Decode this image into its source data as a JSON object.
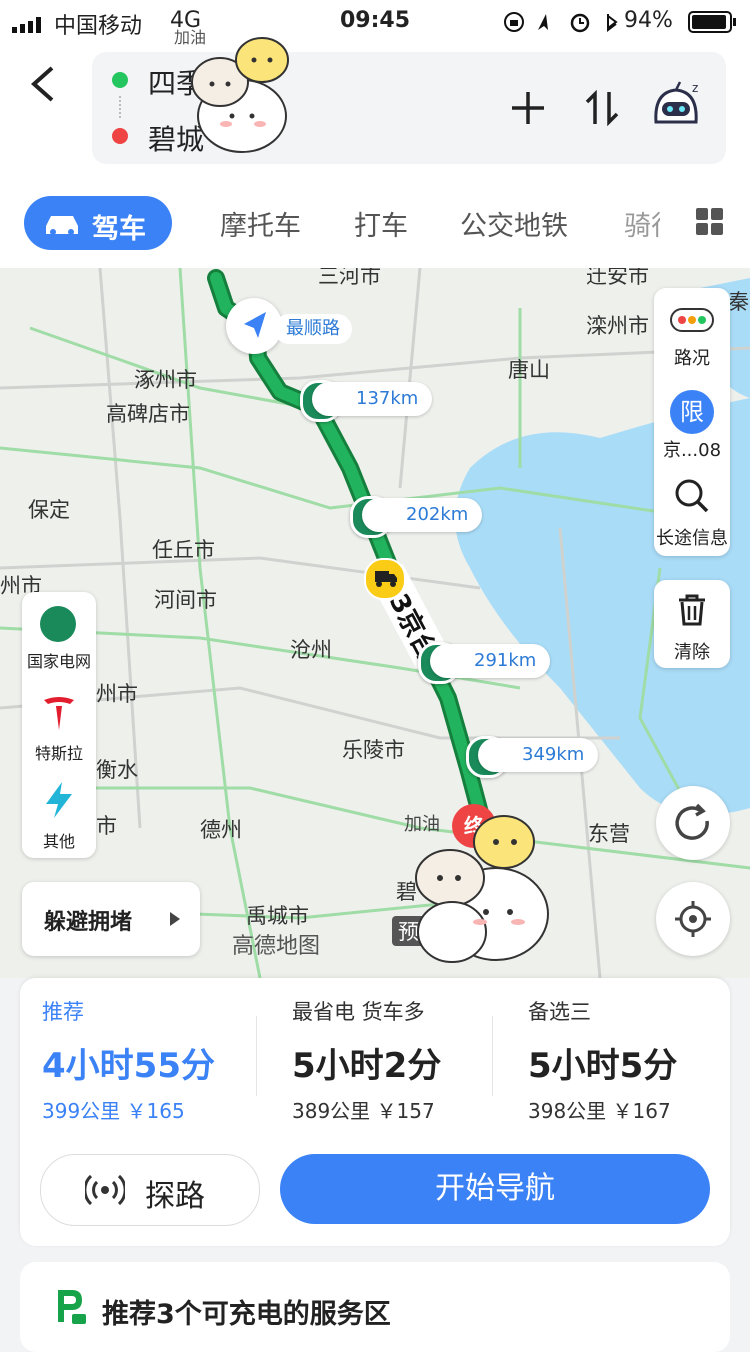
{
  "status_bar": {
    "carrier": "中国移动",
    "network": "4G",
    "time": "09:45",
    "battery": "94%"
  },
  "header": {
    "origin": "四季",
    "destination": "碧城",
    "sticker_text": "加油"
  },
  "tabs": [
    {
      "label": "驾车",
      "active": true
    },
    {
      "label": "摩托车"
    },
    {
      "label": "打车"
    },
    {
      "label": "公交地铁"
    },
    {
      "label": "骑行"
    }
  ],
  "map": {
    "city_labels": [
      "三河市",
      "迁安市",
      "秦",
      "滦州市",
      "涿州市",
      "唐山",
      "高碑店市",
      "保定",
      "任丘市",
      "州市",
      "河间市",
      "沧州",
      "州市",
      "乐陵市",
      "衡水",
      "德州",
      "东营",
      "市",
      "禹城市",
      "碧",
      "预"
    ],
    "route_road_label": "最顺路",
    "highway_label": "G3京台",
    "watermark": "高德地图",
    "end_badge": "终",
    "km_markers": [
      "137km",
      "202km",
      "291km",
      "349km"
    ],
    "right_panel": {
      "traffic_label": "路况",
      "restrict_label": "限",
      "restrict_plate": "京...08",
      "longtrip_label": "长途信息",
      "clear_label": "清除"
    },
    "left_panel": {
      "state_grid": "国家电网",
      "tesla": "特斯拉",
      "other": "其他"
    },
    "avoid_button": "躲避拥堵",
    "colors": {
      "route": "#1fa35a",
      "water": "#a9dcf7",
      "accent": "#3b82f6"
    }
  },
  "routes": [
    {
      "tag": "推荐",
      "time": "4小时55分",
      "distance": "399公里",
      "cost": "￥165",
      "selected": true
    },
    {
      "tag": "最省电 货车多",
      "time": "5小时2分",
      "distance": "389公里",
      "cost": "￥157"
    },
    {
      "tag": "备选三",
      "time": "5小时5分",
      "distance": "398公里",
      "cost": "￥167"
    }
  ],
  "actions": {
    "explore": "探路",
    "start_navigation": "开始导航"
  },
  "charging": {
    "text": "推荐3个可充电的服务区"
  }
}
